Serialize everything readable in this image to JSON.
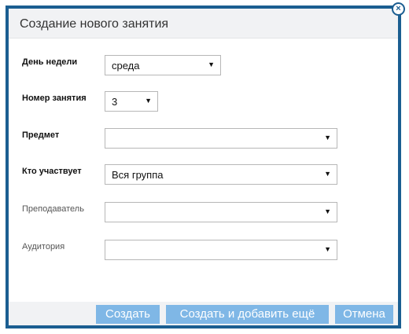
{
  "dialog": {
    "title": "Создание нового занятия",
    "close_glyph": "×"
  },
  "form": {
    "day": {
      "label": "День недели",
      "value": "среда"
    },
    "lesson_number": {
      "label": "Номер занятия",
      "value": "3"
    },
    "subject": {
      "label": "Предмет",
      "value": ""
    },
    "participants": {
      "label": "Кто участвует",
      "value": "Вся группа"
    },
    "teacher": {
      "label": "Преподаватель",
      "value": ""
    },
    "room": {
      "label": "Аудитория",
      "value": ""
    }
  },
  "buttons": {
    "create": "Создать",
    "create_and_add": "Создать и добавить ещё",
    "cancel": "Отмена"
  },
  "colors": {
    "frame": "#1b5e91",
    "button": "#7fb7e6",
    "titlebar": "#f1f2f4"
  }
}
